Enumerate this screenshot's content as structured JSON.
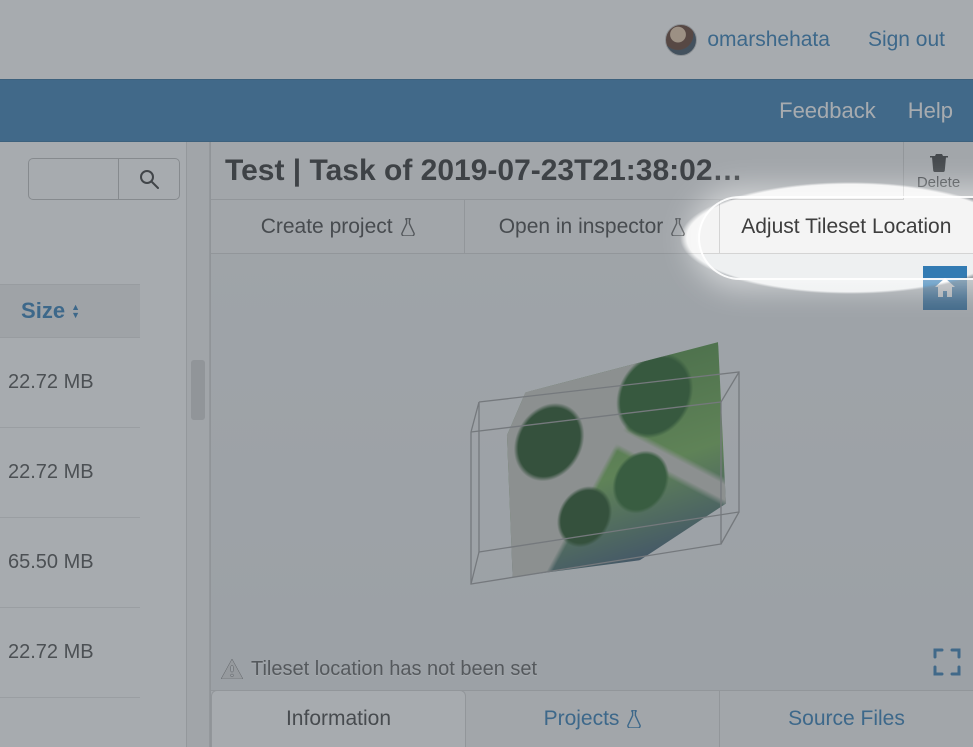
{
  "header": {
    "username": "omarshehata",
    "signout": "Sign out"
  },
  "appbar": {
    "feedback": "Feedback",
    "help": "Help"
  },
  "sidebar": {
    "size_header": "Size",
    "rows": [
      "22.72 MB",
      "22.72 MB",
      "65.50 MB",
      "22.72 MB"
    ]
  },
  "asset": {
    "title": "Test | Task of 2019-07-23T21:38:02…",
    "delete_label": "Delete"
  },
  "actions": {
    "create_project": "Create project",
    "open_inspector": "Open in inspector",
    "adjust_tileset": "Adjust Tileset Location"
  },
  "viewer": {
    "warning": "Tileset location has not been set"
  },
  "tabs": {
    "information": "Information",
    "projects": "Projects",
    "source_files": "Source Files"
  }
}
